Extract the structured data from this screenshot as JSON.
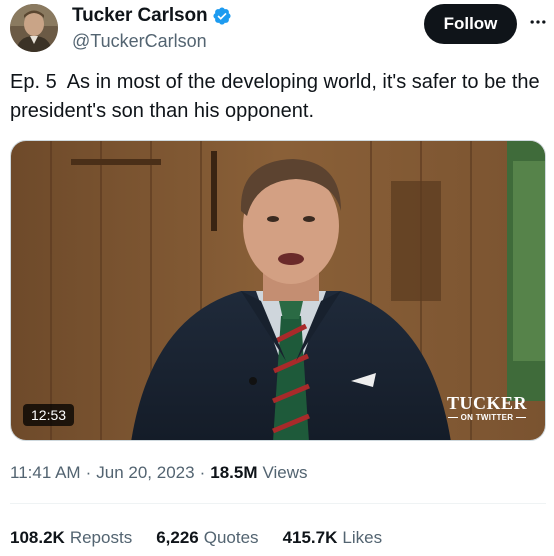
{
  "author": {
    "name": "Tucker Carlson",
    "handle": "@TuckerCarlson",
    "verified": true
  },
  "follow_label": "Follow",
  "more_icon": "more-horizontal-icon",
  "tweet": {
    "text": "Ep. 5  As in most of the developing world, it's safer to be the president's son than his opponent."
  },
  "video": {
    "duration": "12:53",
    "brand_top": "TUCKER",
    "brand_sub": "ON TWITTER"
  },
  "meta": {
    "time": "11:41 AM",
    "date": "Jun 20, 2023",
    "views_count": "18.5M",
    "views_label": "Views"
  },
  "stats": {
    "reposts_count": "108.2K",
    "reposts_label": "Reposts",
    "quotes_count": "6,226",
    "quotes_label": "Quotes",
    "likes_count": "415.7K",
    "likes_label": "Likes"
  },
  "colors": {
    "text": "#0f1419",
    "secondary": "#536471",
    "verified": "#1d9bf0",
    "button": "#0f1419"
  }
}
